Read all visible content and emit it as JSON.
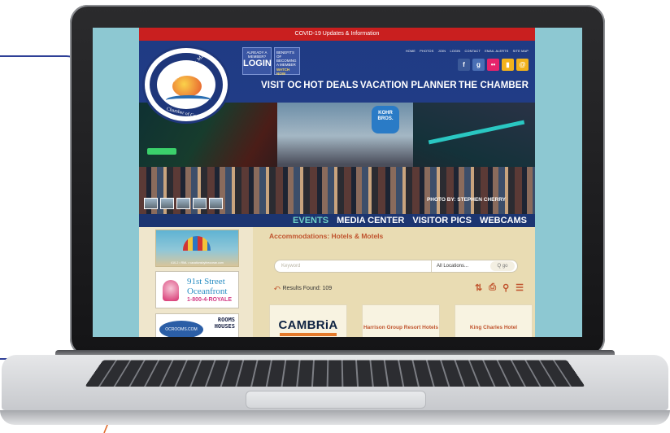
{
  "covid_bar": "COVID-19 Updates & Information",
  "logo": {
    "arc_top": "The Greater Ocean City, Maryland",
    "arc_bottom": "Chamber of Commerce"
  },
  "login": {
    "small": "ALREADY A MEMBER?",
    "big": "LOGIN"
  },
  "benefits": {
    "small": "BENEFITS OF BECOMING A MEMBER",
    "watch": "WATCH NOW"
  },
  "top_links": [
    "HOME",
    "PHOTOS",
    "JOIN",
    "LOGIN",
    "CONTACT",
    "EMAIL ALERTS",
    "SITE MAP"
  ],
  "social": [
    {
      "icon": "facebook-icon",
      "glyph": "f",
      "color": "#3b5998"
    },
    {
      "icon": "google-plus-icon",
      "glyph": "g",
      "color": "#4a6fb5"
    },
    {
      "icon": "flickr-icon",
      "glyph": "••",
      "color": "#e6236b"
    },
    {
      "icon": "bookmark-icon",
      "glyph": "▮",
      "color": "#f2b21c"
    },
    {
      "icon": "email-icon",
      "glyph": "@",
      "color": "#f2b21c"
    }
  ],
  "main_nav": [
    "VISIT OC",
    "HOT DEALS",
    "VACATION PLANNER",
    "THE CHAMBER"
  ],
  "hero": {
    "sign": "KOHR BROS.",
    "credit": "PHOTO BY: STEPHEN CHERRY"
  },
  "sub_nav": [
    "EVENTS",
    "MEDIA CENTER",
    "VISITOR PICS",
    "WEBCAMS"
  ],
  "sidebar_ads": {
    "ad1_text": "410-2 • RML • vacationsbytheocean.com",
    "ad2": {
      "line1": "91st Street",
      "line2": "Oceanfront",
      "line3": "1-800-4-ROYALE"
    },
    "ad3": {
      "oval": "OCROOMS.COM",
      "line1": "ROOMS",
      "line2": "HOUSES"
    }
  },
  "breadcrumb": "Accommodations: Hotels & Motels",
  "search": {
    "placeholder": "Keyword",
    "location": "All Locations...",
    "go": "Q go"
  },
  "results": "Results Found: 109",
  "cards": [
    {
      "name": "CAMBRiA"
    },
    {
      "name": "Harrison Group Resort Hotels"
    },
    {
      "name": "King Charles Hotel"
    }
  ]
}
